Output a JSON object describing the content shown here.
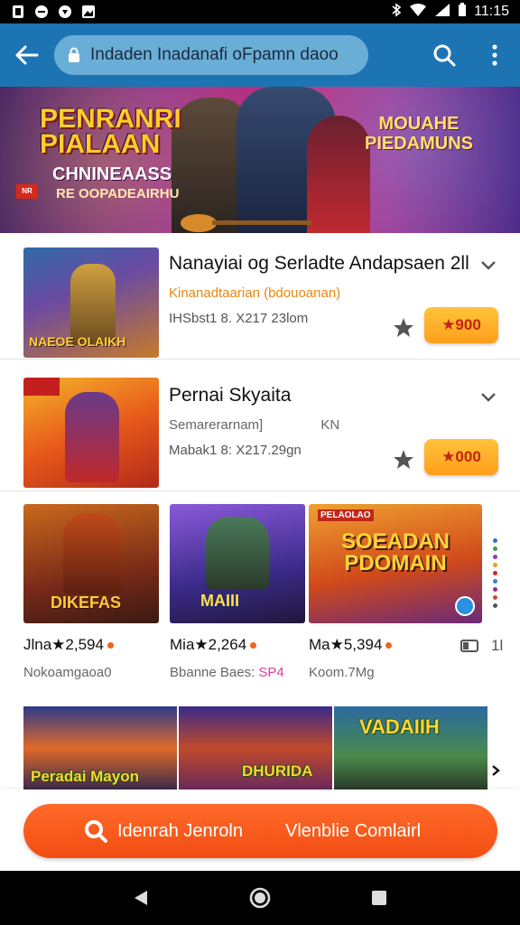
{
  "status_bar": {
    "time": "11:15"
  },
  "toolbar": {
    "url_text": "Indaden Inadanafi oFpamn daoo"
  },
  "banner": {
    "title": "PENRANRI PIALAAN",
    "subtitle": "CHNINEAASS",
    "tagline": "RE OOPADEAIRHU",
    "right_text": "MOUAHE PIEDAMUNS",
    "slides": 3,
    "active_slide": 1
  },
  "list_items": [
    {
      "title": "Nanayiai og Serladte Andapsaen 2ll",
      "subtitle": "Kinanadtaarian (bdouoanan)",
      "meta": "IHSbst1 8. X217 23lom",
      "price": "★900",
      "thumb_caption": "NAEOE OLAIKH"
    },
    {
      "title": "Pernai Skyaita",
      "subtitle": "Semarerarnam]",
      "subtitle_extra": "KN",
      "meta": "Mabak1 8: X217.29gn",
      "price": "★000"
    }
  ],
  "grid_cards": [
    {
      "line1": "Jlna★2,594",
      "line2": "Nokoamgaoa0",
      "thumb_caption": "DIKEFAS"
    },
    {
      "line1": "Mia★2,264",
      "line2": "Bbanne Baes:",
      "line2_accent": "SP4",
      "thumb_caption": "MAIII"
    },
    {
      "line1": "Ma★5,394",
      "line2": "Koom.7Mg",
      "thumb_caption": "SOEADAN PDOMAIN",
      "thumb_tag": "PELAOLAO"
    }
  ],
  "grid_extra": {
    "label": "1l"
  },
  "strip": [
    {
      "caption": "Peradai Mayon"
    },
    {
      "caption": "DHURIDA"
    },
    {
      "caption": "VADAIIH"
    }
  ],
  "cta": {
    "left_label": "Idenrah Jenroln",
    "right_label": "Vlenblie Comlairl"
  },
  "colors": {
    "toolbar": "#1d74b3",
    "accent_orange": "#f24d12",
    "price_gold": "#ffb02a"
  }
}
